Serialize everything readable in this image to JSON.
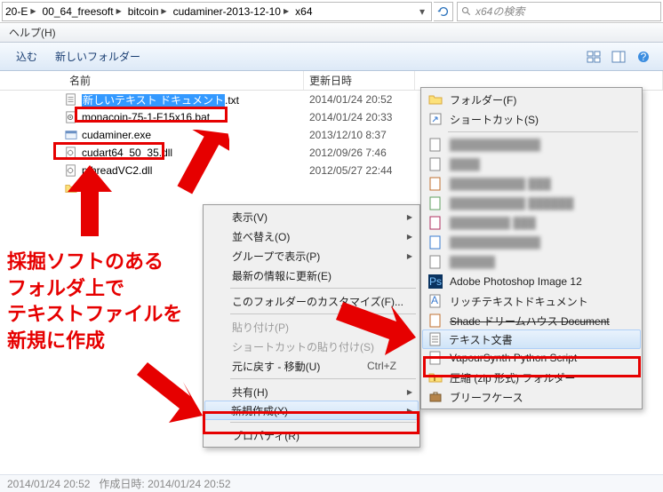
{
  "breadcrumb": [
    "20-E",
    "00_64_freesoft",
    "bitcoin",
    "cudaminer-2013-12-10",
    "x64"
  ],
  "search_placeholder": "x64の検索",
  "menubar": {
    "help": "ヘルプ(H)"
  },
  "toolbar": {
    "include": "込む",
    "new_folder": "新しいフォルダー"
  },
  "columns": {
    "name": "名前",
    "date": "更新日時"
  },
  "files": [
    {
      "name": "新しいテキスト ドキュメント",
      "ext": ".txt",
      "date": "2014/01/24 20:52",
      "type": "txt",
      "editing": true
    },
    {
      "name": "monacoin-75-1-F15x16.bat",
      "ext": "",
      "date": "2014/01/24 20:33",
      "type": "bat"
    },
    {
      "name": "cudaminer.exe",
      "ext": "",
      "date": "2013/12/10 8:37",
      "type": "exe"
    },
    {
      "name": "cudart64_50_35.dll",
      "ext": "",
      "date": "2012/09/26 7:46",
      "type": "dll"
    },
    {
      "name": "pthreadVC2.dll",
      "ext": "",
      "date": "2012/05/27 22:44",
      "type": "dll"
    }
  ],
  "ctx1": {
    "view": "表示(V)",
    "sort": "並べ替え(O)",
    "group": "グループで表示(P)",
    "refresh": "最新の情報に更新(E)",
    "customize": "このフォルダーのカスタマイズ(F)...",
    "paste": "貼り付け(P)",
    "paste_shortcut": "ショートカットの貼り付け(S)",
    "undo": "元に戻す - 移動(U)",
    "undo_sc": "Ctrl+Z",
    "share": "共有(H)",
    "new": "新規作成(X)",
    "props": "プロパティ(R)"
  },
  "ctx2": {
    "folder": "フォルダー(F)",
    "shortcut": "ショートカット(S)",
    "photoshop": "Adobe Photoshop Image 12",
    "rtf": "リッチテキストドキュメント",
    "shade": "Shade ドリームハウス Document",
    "text": "テキスト文書",
    "vapoursynth": "VapourSynth Python Script",
    "zip": "圧縮 (zip 形式) フォルダー",
    "briefcase": "ブリーフケース"
  },
  "annotation_text": "採掘ソフトのある\nフォルダ上で\nテキストファイルを\n新規に作成"
}
